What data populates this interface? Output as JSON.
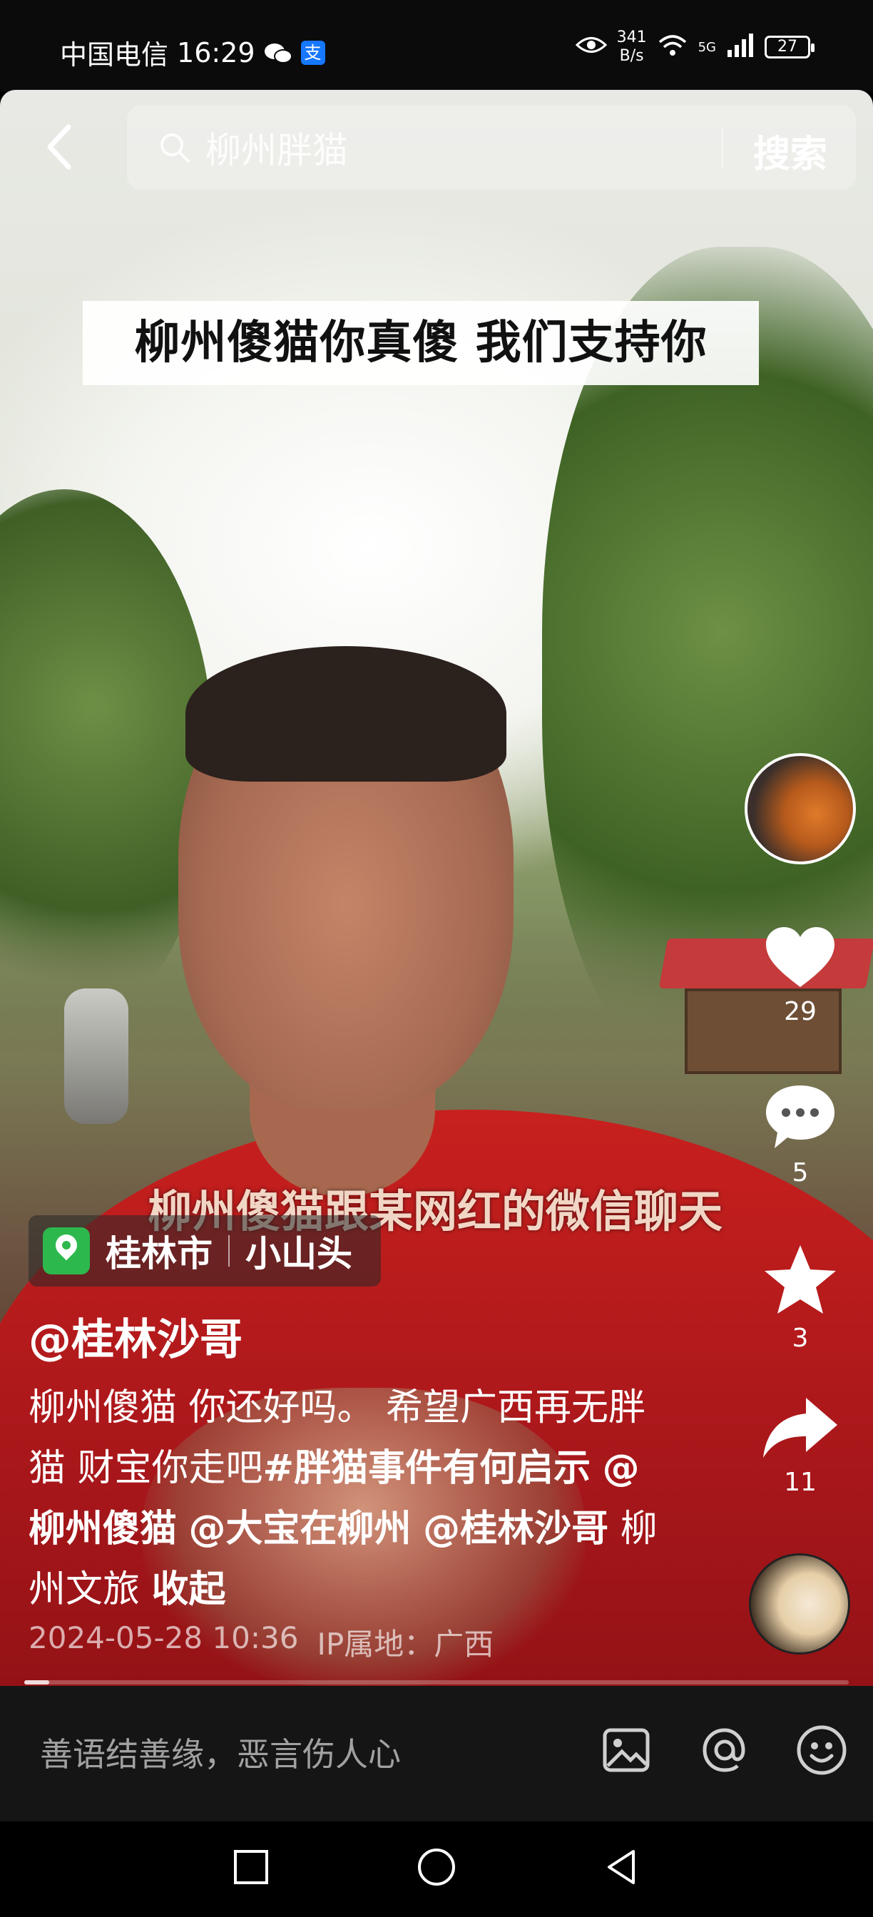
{
  "status_bar": {
    "carrier": "中国电信",
    "time": "16:29",
    "alipay_label": "支",
    "net_speed_value": "341",
    "net_speed_unit": "B/s",
    "network_type": "5G",
    "battery": "27"
  },
  "search": {
    "query": "柳州胖猫",
    "button_label": "搜索"
  },
  "video": {
    "title_overlay": "柳州傻猫你真傻 我们支持你",
    "subtitle": "柳州傻猫跟某网红的微信聊天"
  },
  "location": {
    "city": "桂林市",
    "area": "小山头"
  },
  "post": {
    "author": "@桂林沙哥",
    "description_plain": "柳州傻猫 你还好吗。 希望广西再无胖猫 财宝你走吧",
    "hashtag": "#胖猫事件有何启示",
    "mentions": [
      "@柳州傻猫",
      "@大宝在柳州",
      "@桂林沙哥"
    ],
    "tag_text": "柳州文旅",
    "collapse_label": "收起",
    "datetime": "2024-05-28 10:36",
    "ip_location": "IP属地：广西"
  },
  "actions": {
    "likes": "29",
    "comments": "5",
    "favorites": "3",
    "shares": "11"
  },
  "progress": {
    "played_fraction": 0.03
  },
  "comment_bar": {
    "placeholder": "善语结善缘，恶言伤人心"
  },
  "colors": {
    "location_green": "#2db84d",
    "shirt_red": "#c8201e"
  }
}
